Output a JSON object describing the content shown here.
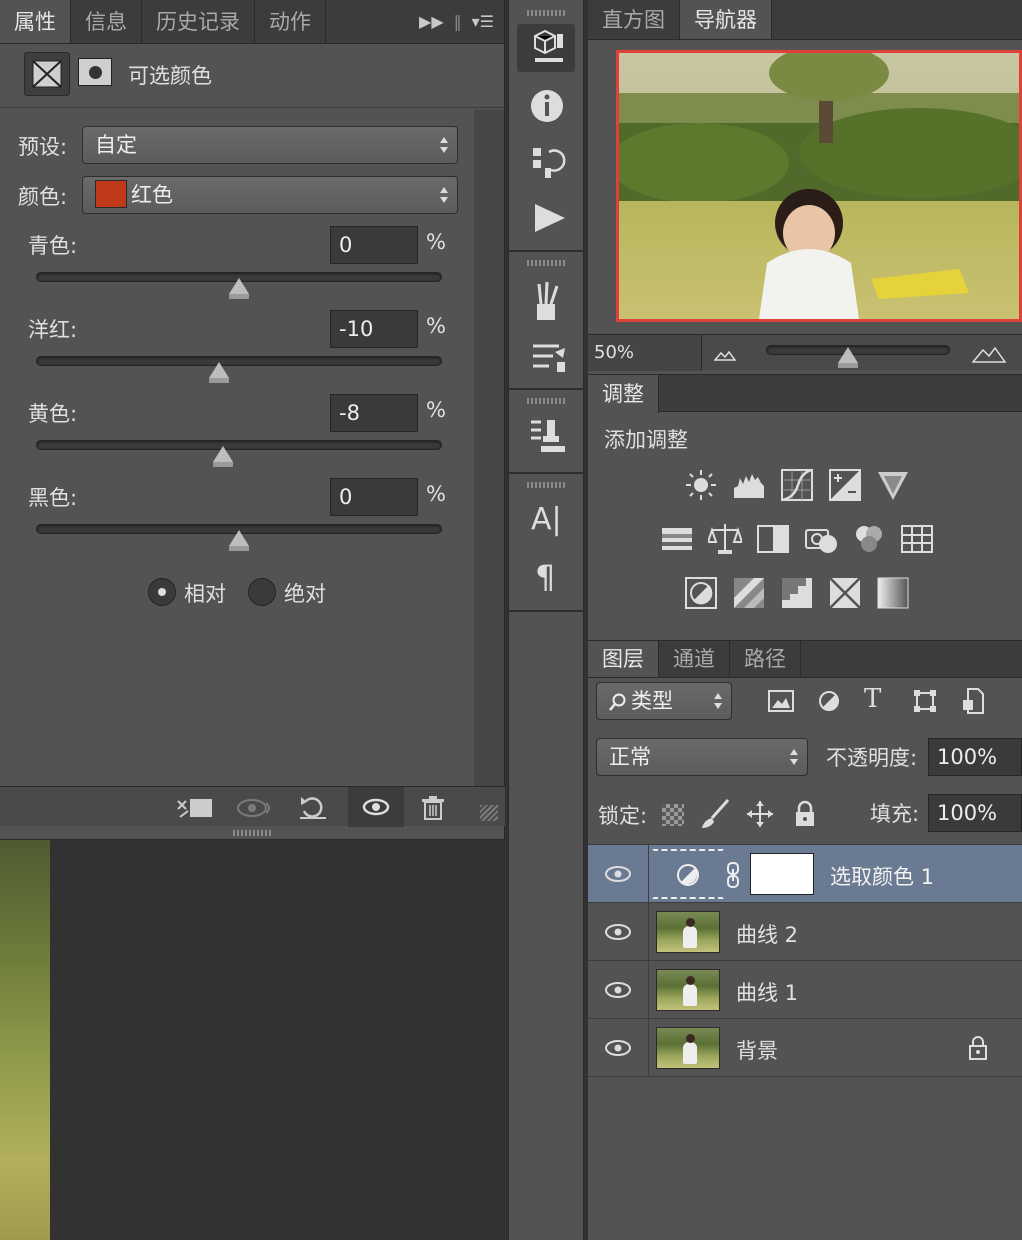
{
  "properties_panel": {
    "tabs": [
      "属性",
      "信息",
      "历史记录",
      "动作"
    ],
    "header_title": "可选颜色",
    "preset_label": "预设:",
    "preset_value": "自定",
    "color_label": "颜色:",
    "color_value": "红色",
    "color_swatch": "#c0391b",
    "sliders": [
      {
        "label": "青色:",
        "value": "0",
        "unit": "%",
        "level": 0.5
      },
      {
        "label": "洋红:",
        "value": "-10",
        "unit": "%",
        "level": 0.45
      },
      {
        "label": "黄色:",
        "value": "-8",
        "unit": "%",
        "level": 0.46
      },
      {
        "label": "黑色:",
        "value": "0",
        "unit": "%",
        "level": 0.5
      }
    ],
    "mode_relative": "相对",
    "mode_absolute": "绝对",
    "mode_selected": "relative"
  },
  "navigator_panel": {
    "tabs": [
      "直方图",
      "导航器"
    ],
    "zoom": "50%"
  },
  "adjustments_panel": {
    "title": "调整",
    "subtitle": "添加调整"
  },
  "layers_panel": {
    "tabs": [
      "图层",
      "通道",
      "路径"
    ],
    "filter_label": "类型",
    "blend_mode": "正常",
    "opacity_label": "不透明度:",
    "opacity_value": "100%",
    "lock_label": "锁定:",
    "fill_label": "填充:",
    "fill_value": "100%",
    "layers": [
      {
        "name": "选取颜色 1",
        "selected": true,
        "type": "adjustment"
      },
      {
        "name": "曲线 2",
        "selected": false,
        "type": "image"
      },
      {
        "name": "曲线 1",
        "selected": false,
        "type": "image"
      },
      {
        "name": "背景",
        "selected": false,
        "type": "image",
        "locked": true
      }
    ]
  },
  "colors": {
    "panel_bg": "#535353",
    "tab_bg": "#3c3c3c",
    "selected_layer": "#6b7a93",
    "navigator_frame": "#e0403a"
  }
}
